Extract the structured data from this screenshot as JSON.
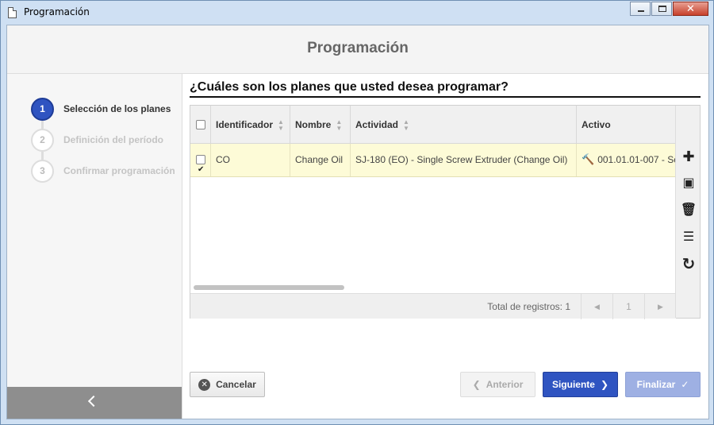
{
  "window": {
    "title": "Programación",
    "close_glyph": "✕"
  },
  "header": {
    "title": "Programación"
  },
  "steps": [
    {
      "number": "1",
      "label": "Selección de los planes",
      "active": true
    },
    {
      "number": "2",
      "label": "Definición del período",
      "active": false
    },
    {
      "number": "3",
      "label": "Confirmar programación",
      "active": false
    }
  ],
  "question": "¿Cuáles son los planes que usted desea programar?",
  "grid": {
    "columns": [
      "Identificador",
      "Nombre",
      "Actividad",
      "Activo"
    ],
    "rows": [
      {
        "checked": true,
        "identificador": "CO",
        "nombre": "Change Oil",
        "actividad": "SJ-180 (EO) - Single Screw Extruder (Change Oil)",
        "activo": "001.01.01-007 - Sc"
      }
    ],
    "footer": {
      "total_label": "Total de registros: 1",
      "page": "1",
      "prev_glyph": "◀",
      "next_glyph": "▶"
    }
  },
  "toolbar": {
    "add_glyph": "✚",
    "view_glyph": "▣",
    "delete_glyph": "🗑",
    "list_glyph": "☰",
    "refresh_glyph": "↻"
  },
  "buttons": {
    "cancel": "Cancelar",
    "cancel_glyph": "✕",
    "previous": "Anterior",
    "previous_glyph": "❮",
    "next": "Siguiente",
    "next_glyph": "❯",
    "finish": "Finalizar",
    "finish_glyph": "✓"
  },
  "colors": {
    "accent": "#2f54c1",
    "selected_row": "#fdfbd7",
    "wrench": "#e08a2a"
  }
}
